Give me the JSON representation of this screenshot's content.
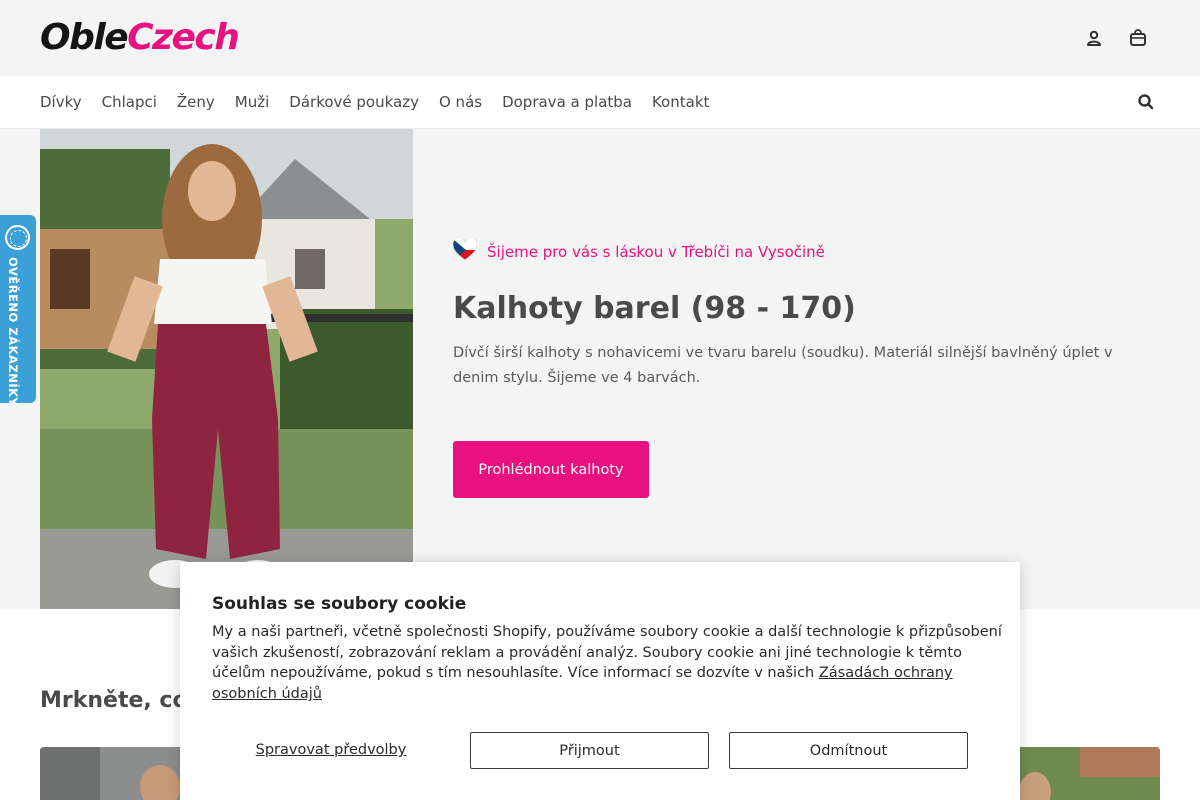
{
  "brand": {
    "logo_part1": "Oble",
    "logo_part2": "Czech",
    "accent": "#e8117f"
  },
  "header": {
    "icons": [
      "account-icon",
      "cart-icon"
    ]
  },
  "nav": {
    "items": [
      "Dívky",
      "Chlapci",
      "Ženy",
      "Muži",
      "Dárkové poukazy",
      "O nás",
      "Doprava a platba",
      "Kontakt"
    ],
    "search_icon": "search-icon"
  },
  "hero": {
    "tagline": "Šijeme pro vás s láskou v Třebíči na Vysočině",
    "flag_icon": "czech-flag-heart-icon",
    "title": "Kalhoty barel (98 - 170)",
    "description": "Dívčí širší kalhoty s nohavicemi ve tvaru barelu (soudku). Materiál silnější bavlněný úplet v denim stylu. Šijeme ve 4 barvách.",
    "button_label": "Prohlédnout kalhoty"
  },
  "side_badge": {
    "label": "OVĚŘENO ZÁKAZNÍKY",
    "color": "#3ba0d8"
  },
  "section": {
    "title": "Mrkněte, co"
  },
  "cookie": {
    "title": "Souhlas se soubory cookie",
    "text": "My a naši partneři, včetně společnosti Shopify, používáme soubory cookie a další technologie k přizpůsobení vašich zkušeností, zobrazování reklam a provádění analýz. Soubory cookie ani jiné technologie k těmto účelům nepoužíváme, pokud s tím nesouhlasíte. Více informací se dozvíte v našich",
    "link": "Zásadách ochrany osobních údajů",
    "manage_label": "Spravovat předvolby",
    "accept_label": "Přijmout",
    "decline_label": "Odmítnout"
  }
}
